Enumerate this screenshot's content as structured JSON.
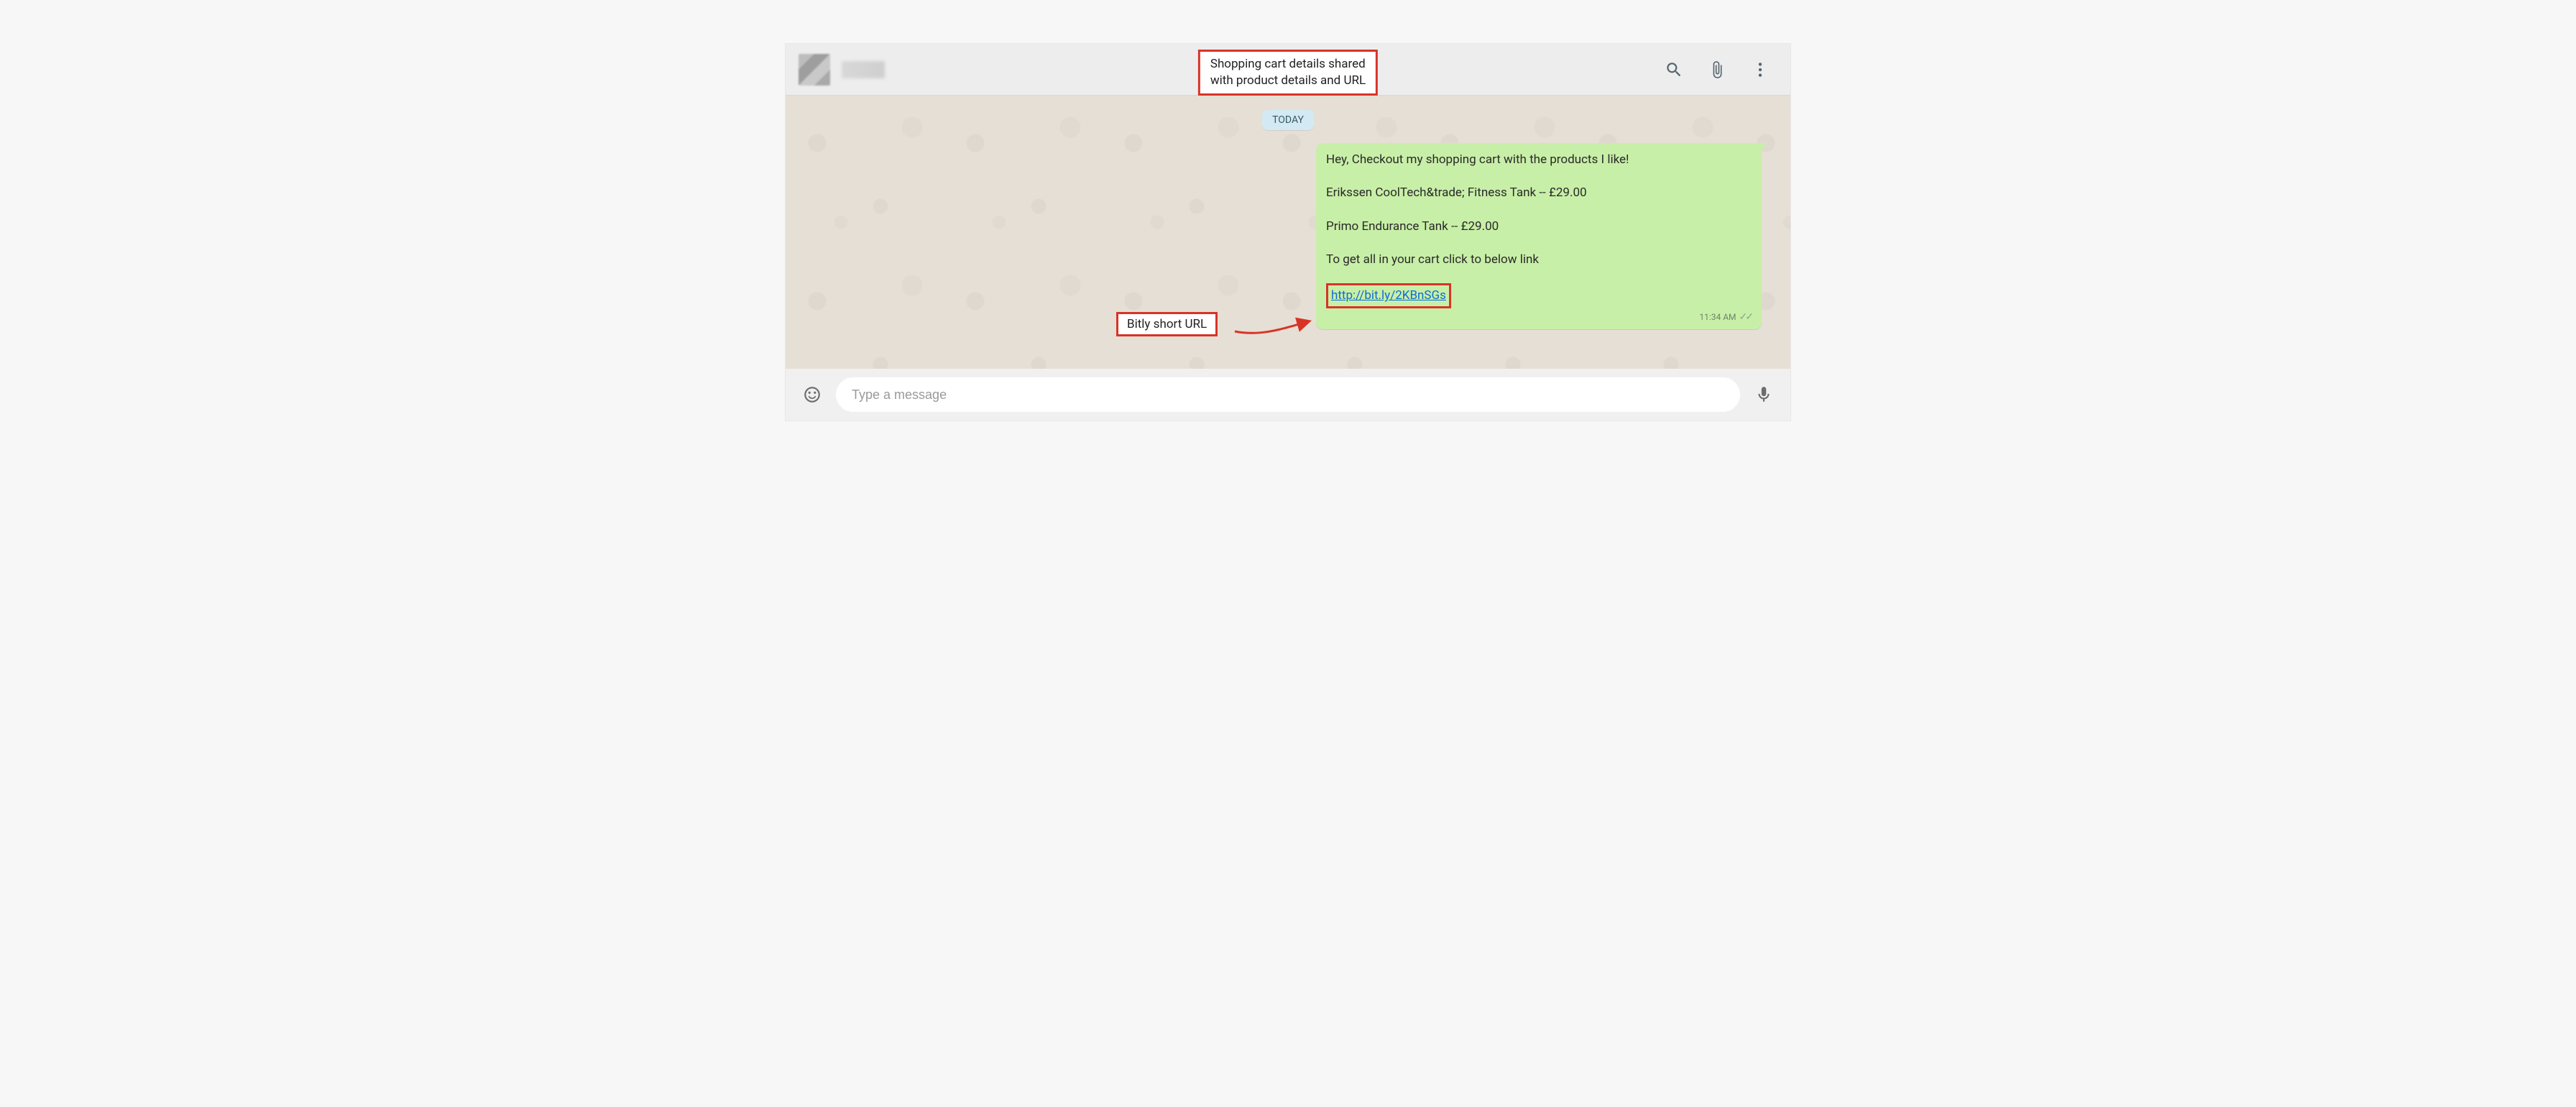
{
  "annotations": {
    "top_callout": "Shopping cart details shared\nwith product details and URL",
    "left_callout": "Bitly short URL"
  },
  "header": {
    "icons": {
      "search": "search-icon",
      "attach": "paperclip-icon",
      "menu": "kebab-menu-icon"
    }
  },
  "chat": {
    "date_chip": "TODAY",
    "message": {
      "lines": [
        "Hey, Checkout my shopping cart with the products I like!",
        "Erikssen CoolTech&trade; Fitness Tank -- £29.00",
        "Primo Endurance Tank -- £29.00",
        "To get all in your cart click to below link"
      ],
      "link_text": "http://bit.ly/2KBnSGs",
      "time": "11:34 AM",
      "status": "read"
    }
  },
  "input": {
    "placeholder": "Type a message"
  }
}
